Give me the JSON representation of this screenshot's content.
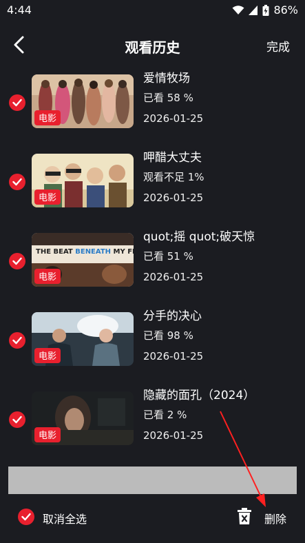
{
  "status": {
    "time": "4:44",
    "battery": "86%"
  },
  "header": {
    "title": "观看历史",
    "done_label": "完成"
  },
  "items": [
    {
      "title": "爱情牧场",
      "progress": "已看 58 %",
      "date": "2026-01-25",
      "badge": "电影"
    },
    {
      "title": "呷醋大丈夫",
      "progress": "观看不足 1%",
      "date": "2026-01-25",
      "badge": "电影"
    },
    {
      "title": "quot;摇 quot;破天惊",
      "progress": "已看 51 %",
      "date": "2026-01-25",
      "badge": "电影",
      "poster_text": {
        "line1": "THE BEAT",
        "line2": "BENEATH",
        "line3": "MY FEET"
      }
    },
    {
      "title": "分手的决心",
      "progress": "已看 98 %",
      "date": "2026-01-25",
      "badge": "电影"
    },
    {
      "title": "隐藏的面孔（2024）",
      "progress": "已看 2 %",
      "date": "2026-01-25",
      "badge": "电影"
    }
  ],
  "footer": {
    "deselect_all_label": "取消全选",
    "delete_label": "删除"
  },
  "colors": {
    "accent": "#e8202e",
    "background": "#1b1c21",
    "annotation_arrow": "#ff2020"
  }
}
